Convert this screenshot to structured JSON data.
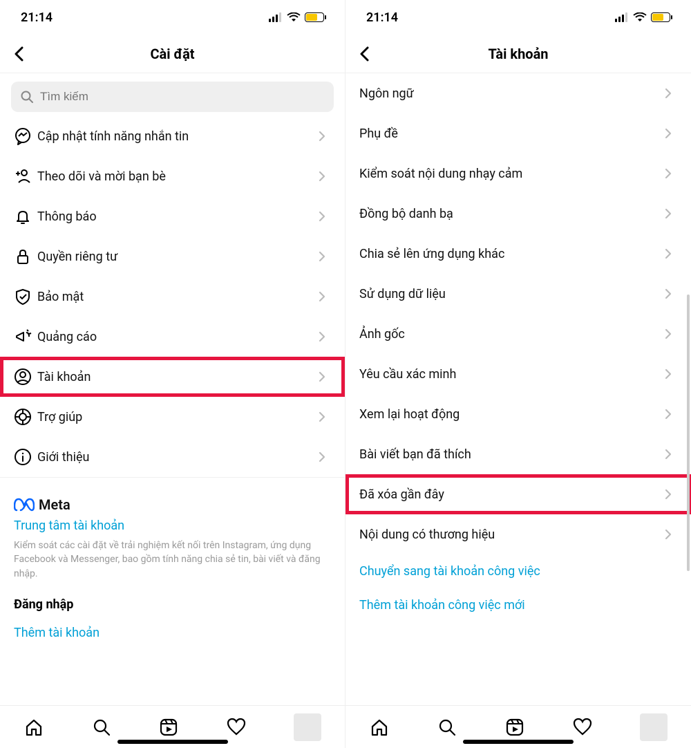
{
  "status": {
    "time": "21:14"
  },
  "left": {
    "title": "Cài đặt",
    "search_placeholder": "Tìm kiếm",
    "items": [
      {
        "icon": "messenger-icon",
        "label": "Cập nhật tính năng nhắn tin",
        "highlighted": false
      },
      {
        "icon": "add-person-icon",
        "label": "Theo dõi và mời bạn bè",
        "highlighted": false
      },
      {
        "icon": "bell-icon",
        "label": "Thông báo",
        "highlighted": false
      },
      {
        "icon": "lock-icon",
        "label": "Quyền riêng tư",
        "highlighted": false
      },
      {
        "icon": "shield-icon",
        "label": "Bảo mật",
        "highlighted": false
      },
      {
        "icon": "megaphone-icon",
        "label": "Quảng cáo",
        "highlighted": false
      },
      {
        "icon": "account-icon",
        "label": "Tài khoản",
        "highlighted": true
      },
      {
        "icon": "help-icon",
        "label": "Trợ giúp",
        "highlighted": false
      },
      {
        "icon": "info-icon",
        "label": "Giới thiệu",
        "highlighted": false
      }
    ],
    "meta_brand": "Meta",
    "meta_link": "Trung tâm tài khoản",
    "meta_desc": "Kiểm soát các cài đặt về trải nghiệm kết nối trên Instagram, ứng dụng Facebook và Messenger, bao gồm tính năng chia sẻ tin, bài viết và đăng nhập.",
    "login_heading": "Đăng nhập",
    "add_account": "Thêm tài khoản"
  },
  "right": {
    "title": "Tài khoản",
    "items": [
      {
        "label": "Ngôn ngữ",
        "highlighted": false
      },
      {
        "label": "Phụ đề",
        "highlighted": false
      },
      {
        "label": "Kiểm soát nội dung nhạy cảm",
        "highlighted": false
      },
      {
        "label": "Đồng bộ danh bạ",
        "highlighted": false
      },
      {
        "label": "Chia sẻ lên ứng dụng khác",
        "highlighted": false
      },
      {
        "label": "Sử dụng dữ liệu",
        "highlighted": false
      },
      {
        "label": "Ảnh gốc",
        "highlighted": false
      },
      {
        "label": "Yêu cầu xác minh",
        "highlighted": false
      },
      {
        "label": "Xem lại hoạt động",
        "highlighted": false
      },
      {
        "label": "Bài viết bạn đã thích",
        "highlighted": false
      },
      {
        "label": "Đã xóa gần đây",
        "highlighted": true
      },
      {
        "label": "Nội dung có thương hiệu",
        "highlighted": false
      }
    ],
    "links": [
      "Chuyển sang tài khoản công việc",
      "Thêm tài khoản công việc mới"
    ]
  }
}
